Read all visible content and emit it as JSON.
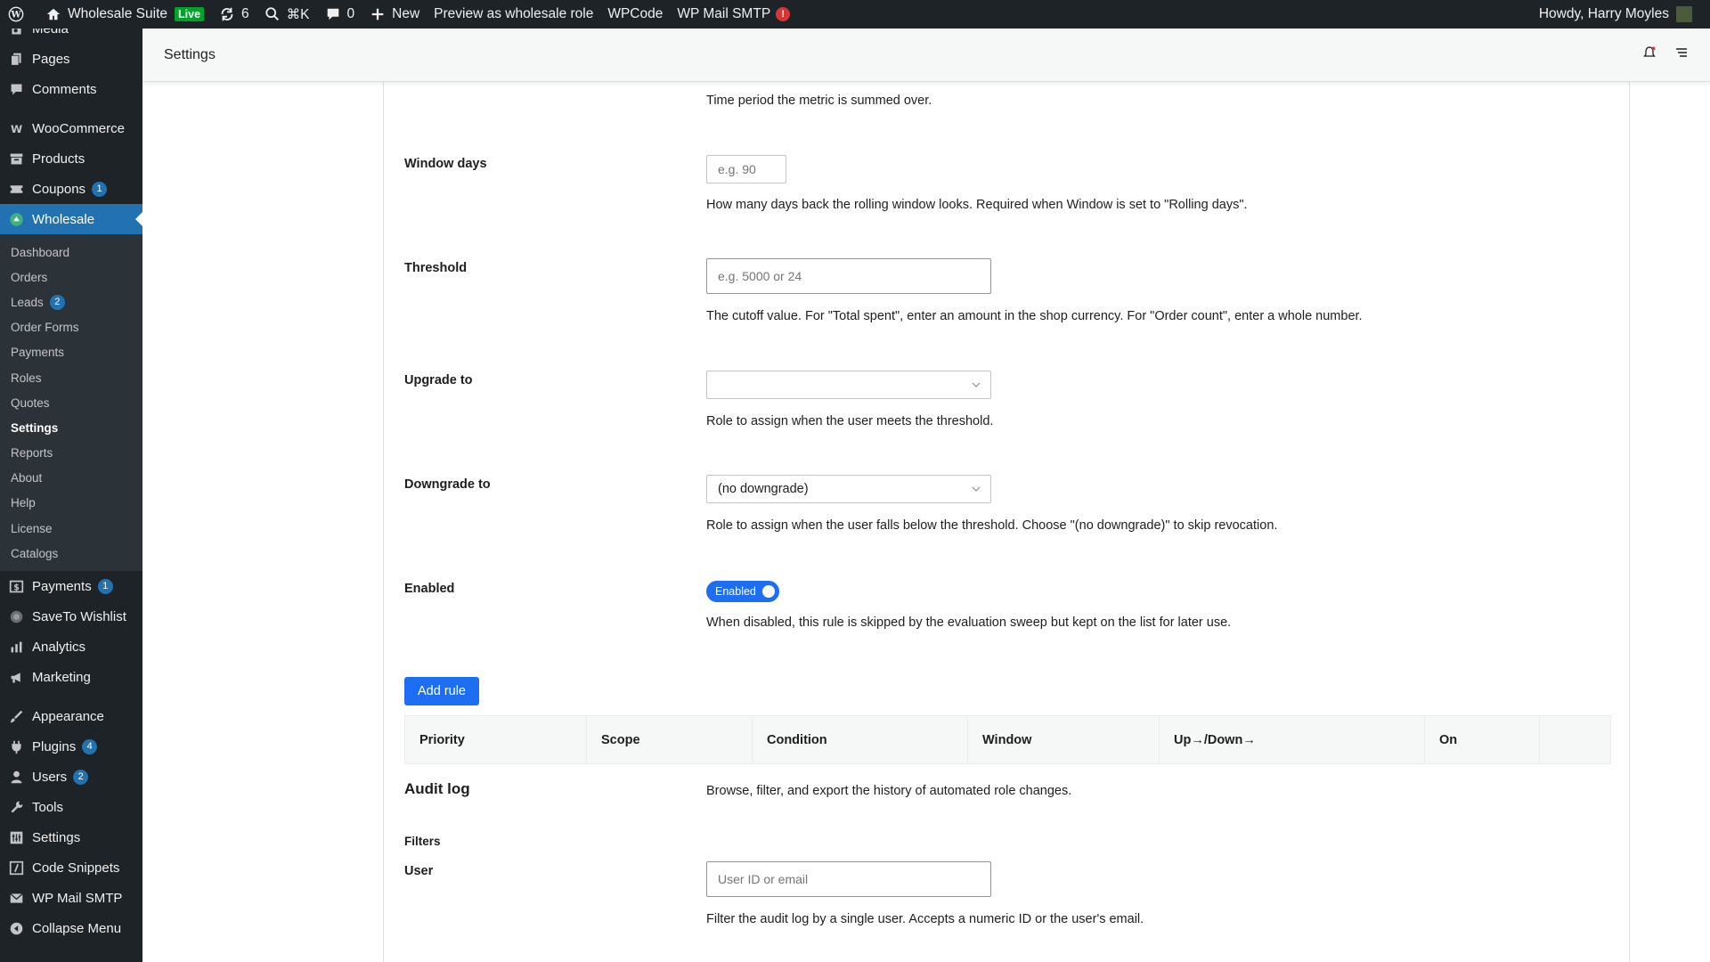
{
  "admin_bar": {
    "site_name": "Wholesale Suite",
    "live_label": "Live",
    "updates_count": "6",
    "search_shortcut": "⌘K",
    "comments_count": "0",
    "new_label": "New",
    "preview_label": "Preview as wholesale role",
    "wpcode_label": "WPCode",
    "smtp_label": "WP Mail SMTP",
    "smtp_alert": "!",
    "howdy": "Howdy, Harry Moyles"
  },
  "sidebar": {
    "items_top": [
      {
        "label": "Media",
        "icon": "media-icon"
      },
      {
        "label": "Pages",
        "icon": "pages-icon"
      },
      {
        "label": "Comments",
        "icon": "comments-icon"
      }
    ],
    "woocommerce": "WooCommerce",
    "products": "Products",
    "coupons": "Coupons",
    "coupons_count": "1",
    "wholesale": "Wholesale",
    "submenu": [
      "Dashboard",
      "Orders",
      "Leads",
      "Order Forms",
      "Payments",
      "Roles",
      "Quotes",
      "Settings",
      "Reports",
      "About",
      "Help",
      "License",
      "Catalogs"
    ],
    "leads_count": "2",
    "payments": "Payments",
    "payments_count": "1",
    "saveto": "SaveTo Wishlist",
    "analytics": "Analytics",
    "marketing": "Marketing",
    "appearance": "Appearance",
    "plugins": "Plugins",
    "plugins_count": "4",
    "users": "Users",
    "users_count": "2",
    "tools": "Tools",
    "settings": "Settings",
    "code_snippets": "Code Snippets",
    "wp_mail_smtp": "WP Mail SMTP",
    "collapse": "Collapse Menu"
  },
  "header": {
    "title": "Settings"
  },
  "form": {
    "window_desc": "Time period the metric is summed over.",
    "window_days_label": "Window days",
    "window_days_placeholder": "e.g. 90",
    "window_days_desc": "How many days back the rolling window looks. Required when Window is set to \"Rolling days\".",
    "threshold_label": "Threshold",
    "threshold_placeholder": "e.g. 5000 or 24",
    "threshold_desc": "The cutoff value. For \"Total spent\", enter an amount in the shop currency. For \"Order count\", enter a whole number.",
    "upgrade_label": "Upgrade to",
    "upgrade_value": "",
    "upgrade_desc": "Role to assign when the user meets the threshold.",
    "downgrade_label": "Downgrade to",
    "downgrade_value": "(no downgrade)",
    "downgrade_desc": "Role to assign when the user falls below the threshold. Choose \"(no downgrade)\" to skip revocation.",
    "enabled_label": "Enabled",
    "enabled_toggle": "Enabled",
    "enabled_desc": "When disabled, this rule is skipped by the evaluation sweep but kept on the list for later use.",
    "add_rule": "Add rule"
  },
  "rules_table": {
    "columns": [
      "Priority",
      "Scope",
      "Condition",
      "Window",
      "Up→/Down→",
      "On",
      ""
    ]
  },
  "audit": {
    "title": "Audit log",
    "desc": "Browse, filter, and export the history of automated role changes.",
    "filters_label": "Filters",
    "user_label": "User",
    "user_placeholder": "User ID or email",
    "user_desc": "Filter the audit log by a single user. Accepts a numeric ID or the user's email."
  },
  "colors": {
    "admin_bg": "#1d2327",
    "accent": "#2271b1",
    "primary_button": "#1d6ef2",
    "live": "#00a32a",
    "alert": "#d63638"
  }
}
